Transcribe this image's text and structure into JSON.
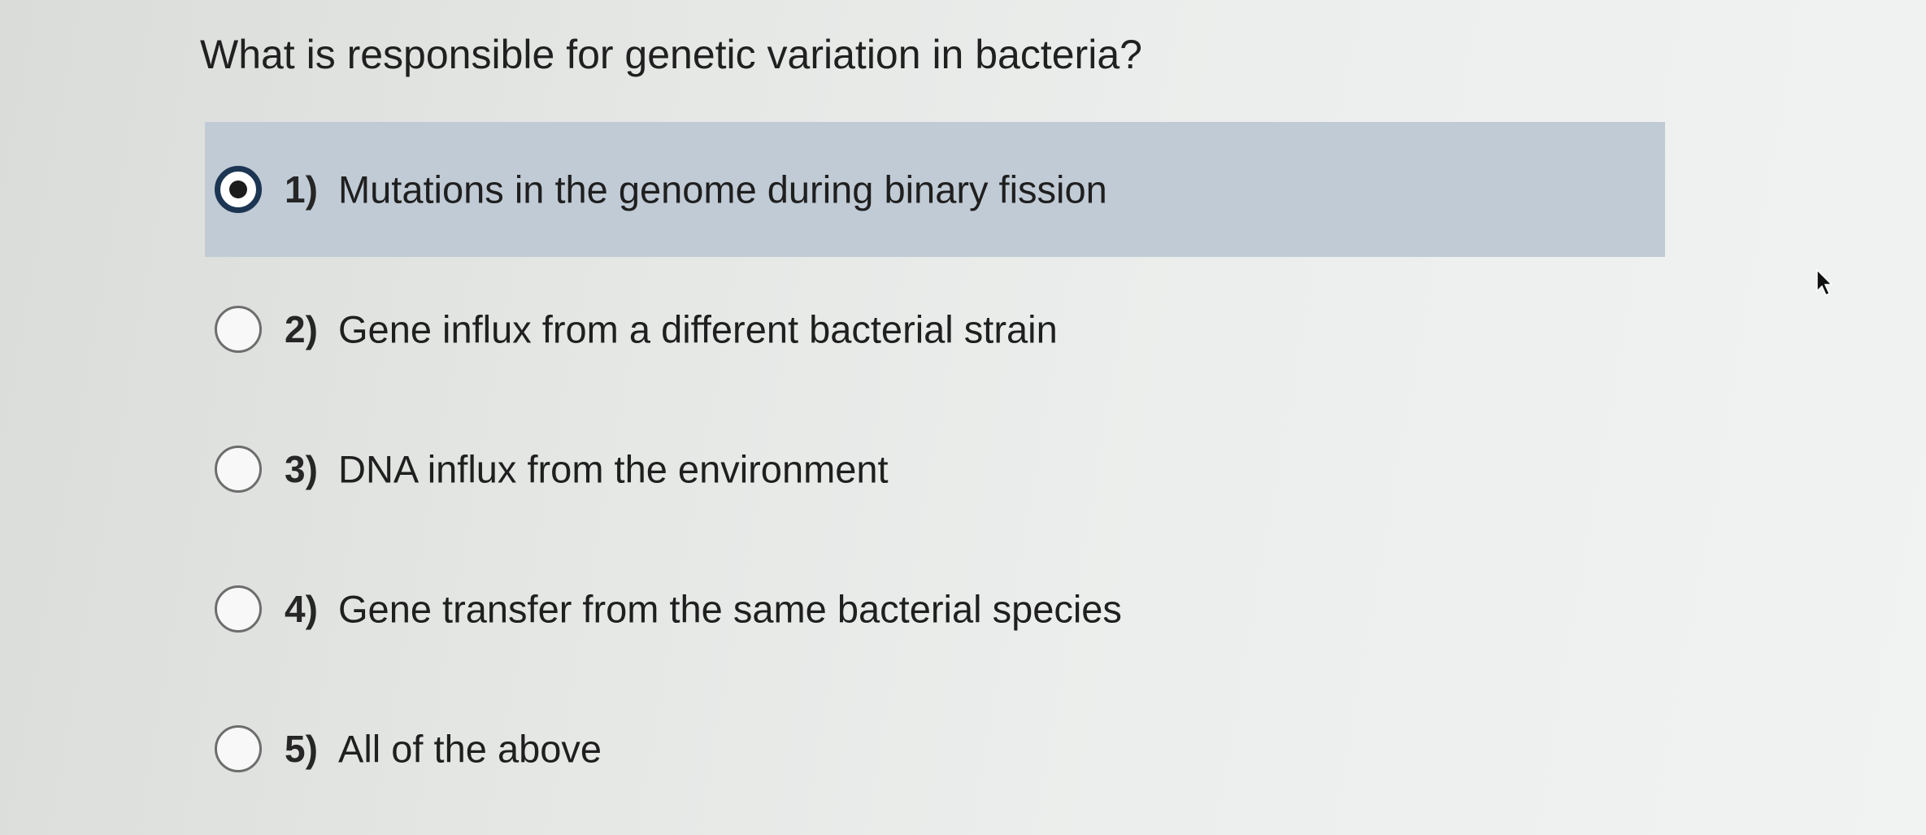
{
  "question": {
    "text": "What is responsible for genetic variation in bacteria?"
  },
  "options": [
    {
      "number": "1)",
      "label": "Mutations in the genome during binary fission",
      "selected": true
    },
    {
      "number": "2)",
      "label": "Gene influx from a different bacterial strain",
      "selected": false
    },
    {
      "number": "3)",
      "label": "DNA influx from the environment",
      "selected": false
    },
    {
      "number": "4)",
      "label": "Gene transfer from the same bacterial species",
      "selected": false
    },
    {
      "number": "5)",
      "label": "All of the above",
      "selected": false
    }
  ],
  "icons": {
    "selected_radio": "radio-selected-icon",
    "unselected_radio": "radio-unselected-icon",
    "cursor": "mouse-cursor-icon"
  },
  "colors": {
    "selected_background": "#c1cbd5",
    "selected_radio_ring": "#1c3553"
  }
}
